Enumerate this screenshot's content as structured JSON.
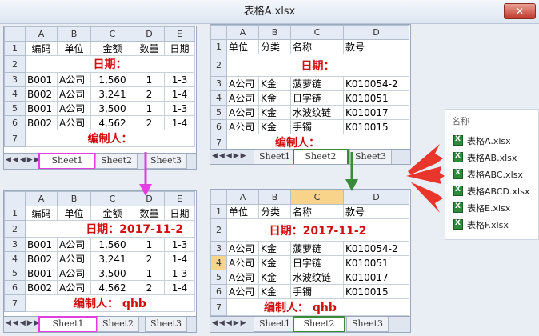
{
  "window": {
    "title": "表格A.xlsx",
    "close": "✕"
  },
  "cols5": [
    "A",
    "B",
    "C",
    "D",
    "E"
  ],
  "cols4": [
    "A",
    "B",
    "C",
    "D"
  ],
  "tl": {
    "rows": [
      "1",
      "2",
      "3",
      "4",
      "5",
      "6",
      "7"
    ],
    "header": [
      "编码",
      "单位",
      "金额",
      "数量",
      "日期"
    ],
    "date_label": "日期：",
    "data": [
      [
        "B001",
        "A公司",
        "1,560",
        "1",
        "1-3"
      ],
      [
        "B002",
        "A公司",
        "3,241",
        "2",
        "1-4"
      ],
      [
        "B001",
        "A公司",
        "3,500",
        "1",
        "1-3"
      ],
      [
        "B002",
        "A公司",
        "4,562",
        "2",
        "1-4"
      ]
    ],
    "author_label": "编制人：",
    "tabs": [
      "Sheet1",
      "Sheet2",
      "Sheet3"
    ]
  },
  "bl": {
    "rows": [
      "1",
      "2",
      "3",
      "4",
      "5",
      "6",
      "7"
    ],
    "header": [
      "编码",
      "单位",
      "金额",
      "数量",
      "日期"
    ],
    "date_label": "日期：2017-11-2",
    "data": [
      [
        "B001",
        "A公司",
        "1,560",
        "1",
        "1-3"
      ],
      [
        "B002",
        "A公司",
        "3,241",
        "2",
        "1-4"
      ],
      [
        "B001",
        "A公司",
        "3,500",
        "1",
        "1-3"
      ],
      [
        "B002",
        "A公司",
        "4,562",
        "2",
        "1-4"
      ]
    ],
    "author_label": "编制人：  qhb",
    "tabs": [
      "Sheet1",
      "Sheet2",
      "Sheet3"
    ]
  },
  "tr": {
    "rows": [
      "1",
      "2",
      "3",
      "4",
      "5",
      "6",
      "7"
    ],
    "header": [
      "单位",
      "分类",
      "名称",
      "款号"
    ],
    "date_label": "日期：",
    "data": [
      [
        "A公司",
        "K金",
        "菠萝链",
        "K010054-2"
      ],
      [
        "A公司",
        "K金",
        "日字链",
        "K010051"
      ],
      [
        "A公司",
        "K金",
        "水波纹链",
        "K010017"
      ],
      [
        "A公司",
        "K金",
        "手镯",
        "K010015"
      ]
    ],
    "author_label": "编制人：",
    "tabs": [
      "Sheet1",
      "Sheet2",
      "Sheet3"
    ]
  },
  "br": {
    "rows": [
      "1",
      "2",
      "3",
      "4",
      "5",
      "6",
      "7"
    ],
    "header": [
      "单位",
      "分类",
      "名称",
      "款号"
    ],
    "date_label": "日期：2017-11-2",
    "data": [
      [
        "A公司",
        "K金",
        "菠萝链",
        "K010054-2"
      ],
      [
        "A公司",
        "K金",
        "日字链",
        "K010051"
      ],
      [
        "A公司",
        "K金",
        "水波纹链",
        "K010017"
      ],
      [
        "A公司",
        "K金",
        "手镯",
        "K010015"
      ]
    ],
    "author_label": "编制人：  qhb",
    "tabs": [
      "Sheet1",
      "Sheet2",
      "Sheet3"
    ]
  },
  "files": {
    "header": "名称",
    "items": [
      "表格A.xlsx",
      "表格AB.xlsx",
      "表格ABC.xlsx",
      "表格ABCD.xlsx",
      "表格E.xlsx",
      "表格F.xlsx"
    ]
  },
  "colors": {
    "pink": "#e23ee0",
    "green": "#3a8a3a",
    "red_arrow": "#e8362c",
    "red_text": "#d01010"
  }
}
